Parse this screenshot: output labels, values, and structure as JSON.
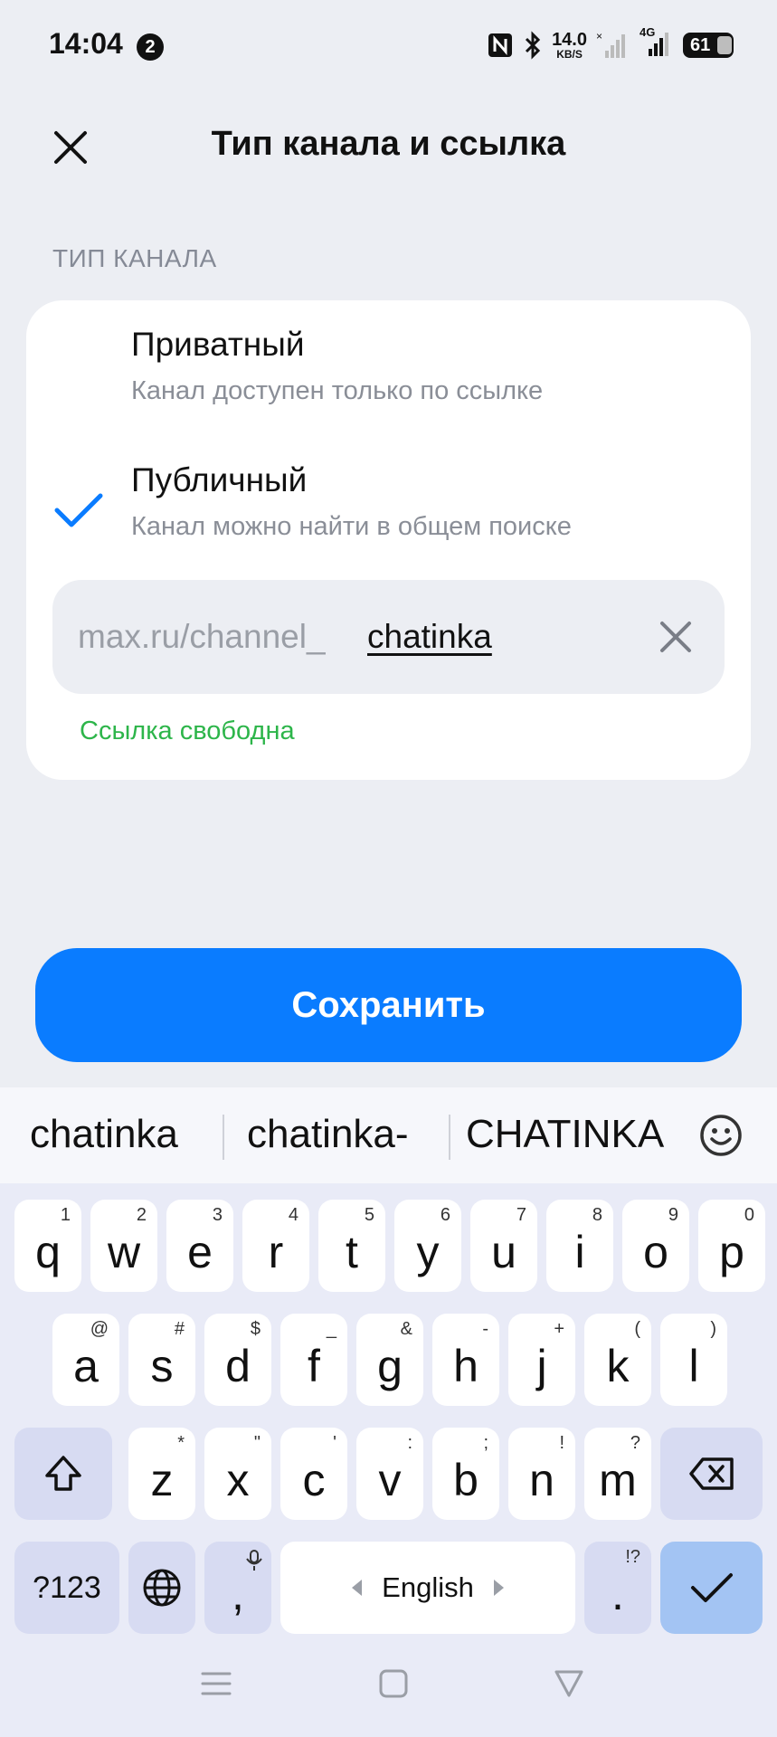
{
  "status_bar": {
    "time": "14:04",
    "notification_count": "2",
    "net_speed": "14.0",
    "net_speed_unit": "KB/S",
    "network_type": "4G",
    "battery": "61"
  },
  "header": {
    "title": "Тип канала и ссылка",
    "close_icon": "close-icon"
  },
  "section": {
    "label": "ТИП КАНАЛА"
  },
  "options": [
    {
      "title": "Приватный",
      "subtitle": "Канал доступен только по ссылке",
      "selected": false
    },
    {
      "title": "Публичный",
      "subtitle": "Канал можно найти в общем поиске",
      "selected": true
    }
  ],
  "link_field": {
    "prefix": "max.ru/channel_",
    "value": "chatinka"
  },
  "link_status": "Ссылка свободна",
  "save_label": "Сохранить",
  "colors": {
    "accent": "#0a7cff",
    "success": "#2db54a",
    "background": "#eceef3"
  },
  "keyboard": {
    "suggestions": [
      "chatinka",
      "chatinka-",
      "CHATINKA"
    ],
    "row1": [
      {
        "key": "q",
        "hint": "1"
      },
      {
        "key": "w",
        "hint": "2"
      },
      {
        "key": "e",
        "hint": "3"
      },
      {
        "key": "r",
        "hint": "4"
      },
      {
        "key": "t",
        "hint": "5"
      },
      {
        "key": "y",
        "hint": "6"
      },
      {
        "key": "u",
        "hint": "7"
      },
      {
        "key": "i",
        "hint": "8"
      },
      {
        "key": "o",
        "hint": "9"
      },
      {
        "key": "p",
        "hint": "0"
      }
    ],
    "row2": [
      {
        "key": "a",
        "hint": "@"
      },
      {
        "key": "s",
        "hint": "#"
      },
      {
        "key": "d",
        "hint": "$"
      },
      {
        "key": "f",
        "hint": "_"
      },
      {
        "key": "g",
        "hint": "&"
      },
      {
        "key": "h",
        "hint": "-"
      },
      {
        "key": "j",
        "hint": "+"
      },
      {
        "key": "k",
        "hint": "("
      },
      {
        "key": "l",
        "hint": ")"
      }
    ],
    "row3": [
      {
        "key": "z",
        "hint": "*"
      },
      {
        "key": "x",
        "hint": "\""
      },
      {
        "key": "c",
        "hint": "'"
      },
      {
        "key": "v",
        "hint": ":"
      },
      {
        "key": "b",
        "hint": ";"
      },
      {
        "key": "n",
        "hint": "!"
      },
      {
        "key": "m",
        "hint": "?"
      }
    ],
    "symbols_label": "?123",
    "comma": ",",
    "space_label": "English",
    "period": ".",
    "period_hint": "!?"
  }
}
